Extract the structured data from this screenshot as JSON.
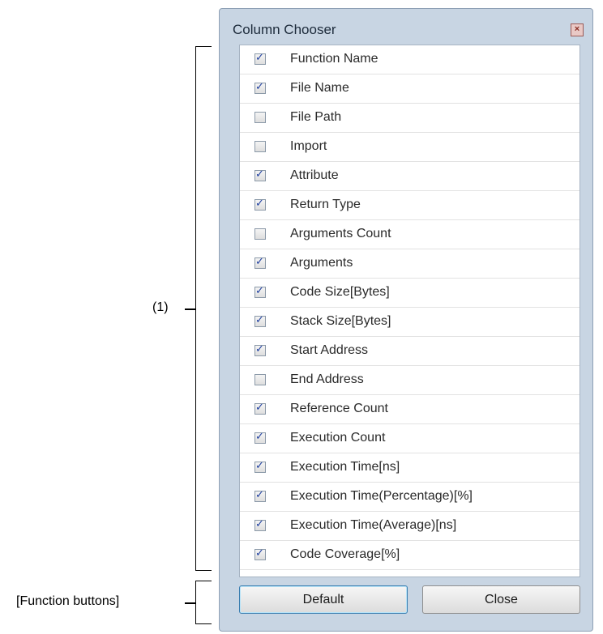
{
  "dialog": {
    "title": "Column Chooser",
    "close_glyph": "×"
  },
  "columns": [
    {
      "label": "Function Name",
      "checked": true
    },
    {
      "label": "File Name",
      "checked": true
    },
    {
      "label": "File Path",
      "checked": false
    },
    {
      "label": "Import",
      "checked": false
    },
    {
      "label": "Attribute",
      "checked": true
    },
    {
      "label": "Return Type",
      "checked": true
    },
    {
      "label": "Arguments Count",
      "checked": false
    },
    {
      "label": "Arguments",
      "checked": true
    },
    {
      "label": "Code Size[Bytes]",
      "checked": true
    },
    {
      "label": "Stack Size[Bytes]",
      "checked": true
    },
    {
      "label": "Start Address",
      "checked": true
    },
    {
      "label": "End Address",
      "checked": false
    },
    {
      "label": "Reference Count",
      "checked": true
    },
    {
      "label": "Execution Count",
      "checked": true
    },
    {
      "label": "Execution Time[ns]",
      "checked": true
    },
    {
      "label": "Execution Time(Percentage)[%]",
      "checked": true
    },
    {
      "label": "Execution Time(Average)[ns]",
      "checked": true
    },
    {
      "label": "Code Coverage[%]",
      "checked": true
    }
  ],
  "buttons": {
    "default_label": "Default",
    "close_label": "Close"
  },
  "annotations": {
    "list_label": "(1)",
    "buttons_label": "[Function buttons]"
  }
}
